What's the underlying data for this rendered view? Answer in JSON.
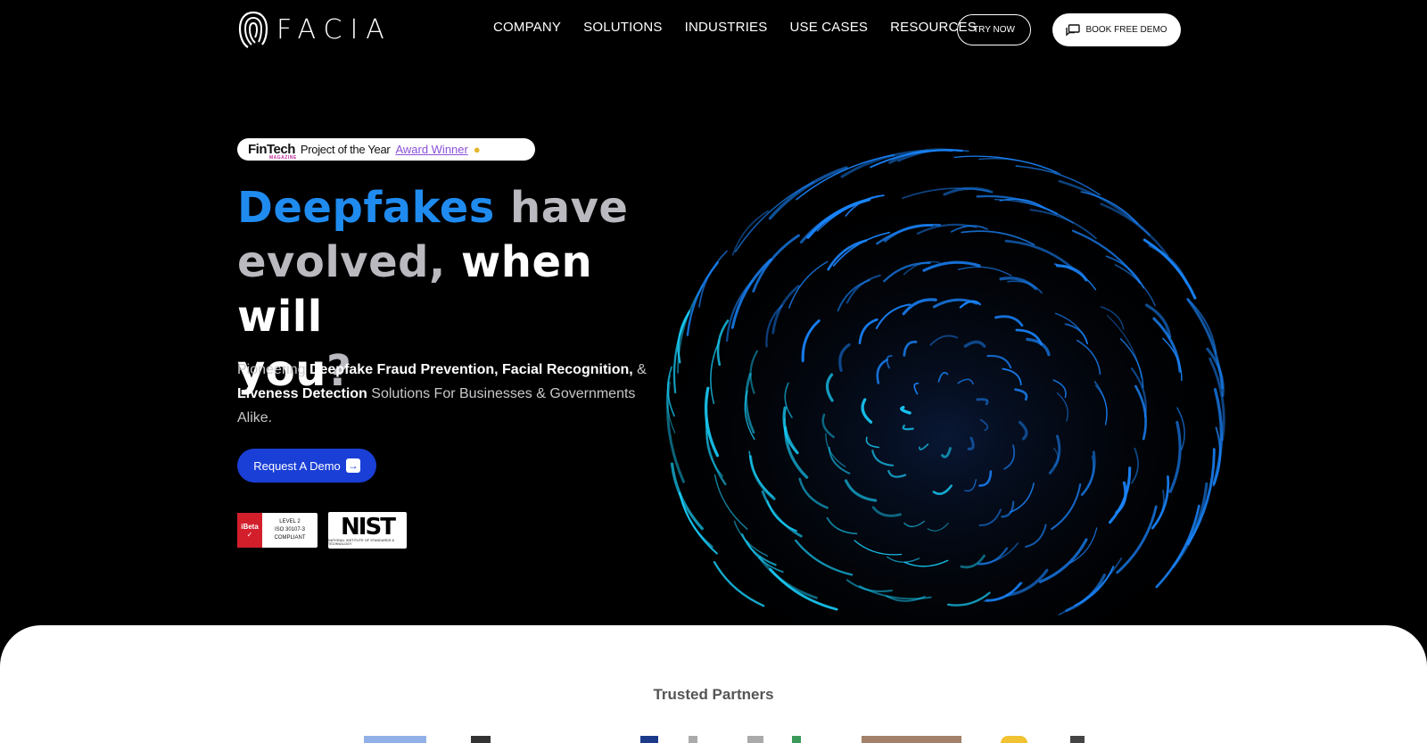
{
  "header": {
    "logo_text": "FACIA",
    "nav": [
      "COMPANY",
      "SOLUTIONS",
      "INDUSTRIES",
      "USE CASES",
      "RESOURCES"
    ],
    "try_now": "TRY NOW",
    "book_demo": "BOOK FREE DEMO"
  },
  "hero": {
    "award": {
      "brand": "FinTech",
      "brand_sub": "MAGAZINE",
      "text": "Project of the Year",
      "highlight": "Award Winner"
    },
    "headline": {
      "part1": "Deepfakes",
      "part2": " have",
      "part3": "evolved,",
      "part4": " when will",
      "part5": "you",
      "part6": "?"
    },
    "sub": {
      "t1": "Pioneering ",
      "b1": "Deepfake Fraud Prevention, Facial Recognition,",
      "t2": " & ",
      "b2": "Liveness Detection",
      "t3": " Solutions For Businesses & Governments Alike."
    },
    "cta": "Request A Demo",
    "certs": {
      "ibeta_brand": "iBeta",
      "ibeta_line1": "LEVEL 2",
      "ibeta_line2": "ISO 30107-3",
      "ibeta_line3": "COMPLIANT",
      "nist": "NIST",
      "nist_sub": "NATIONAL INSTITUTE OF STANDARDS & TECHNOLOGY"
    }
  },
  "partners": {
    "title": "Trusted Partners"
  },
  "colors": {
    "accent_blue": "#1f8bef",
    "cta_blue": "#1a3fd6",
    "swirl": "#14b8ff"
  }
}
